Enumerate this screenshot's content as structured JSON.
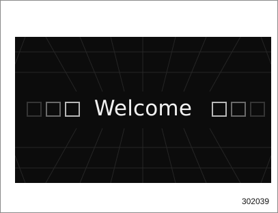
{
  "screen": {
    "greeting": "Welcome",
    "background_color": "#0c0c0c",
    "text_color": "#f2f2f2"
  },
  "figure": {
    "id": "302039"
  }
}
